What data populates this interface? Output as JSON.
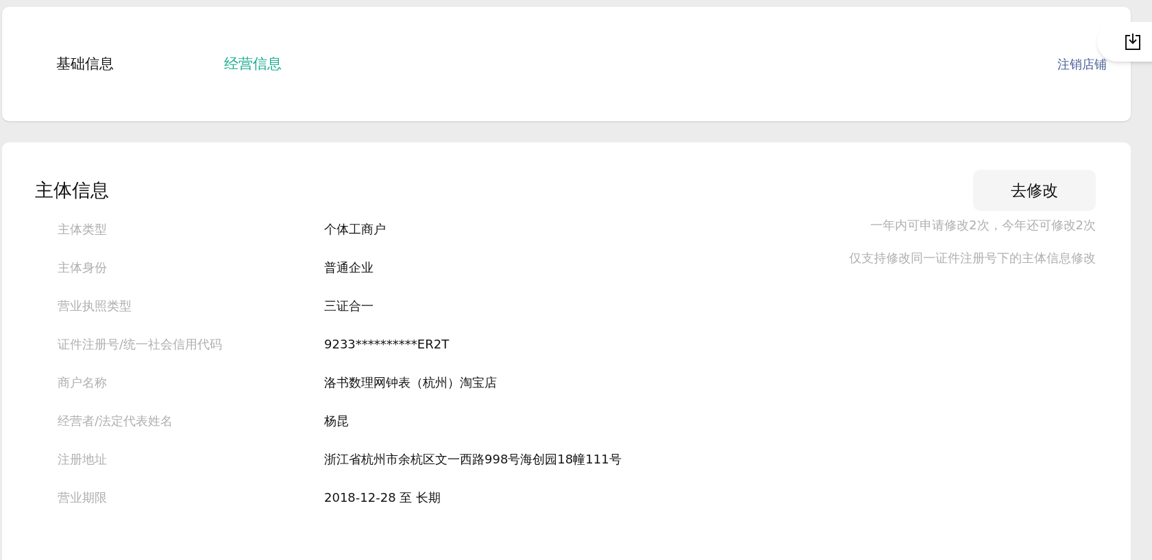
{
  "tabs": [
    {
      "label": "基础信息",
      "selected": false
    },
    {
      "label": "经营信息",
      "selected": true
    }
  ],
  "header_link": "注销店铺",
  "section": {
    "title": "主体信息",
    "button": "去修改",
    "notes": [
      "一年内可申请修改2次，今年还可修改2次",
      "仅支持修改同一证件注册号下的主体信息修改"
    ],
    "fields": [
      {
        "label": "主体类型",
        "value": "个体工商户"
      },
      {
        "label": "主体身份",
        "value": "普通企业"
      },
      {
        "label": "营业执照类型",
        "value": "三证合一"
      },
      {
        "label": "证件注册号/统一社会信用代码",
        "value": "9233**********ER2T"
      },
      {
        "label": "商户名称",
        "value": "洛书数理网钟表（杭州）淘宝店"
      },
      {
        "label": "经营者/法定代表姓名",
        "value": "杨昆"
      },
      {
        "label": "注册地址",
        "value": "浙江省杭州市余杭区文一西路998号海创园18幢111号"
      },
      {
        "label": "营业期限",
        "value": "2018-12-28 至 长期"
      }
    ]
  }
}
